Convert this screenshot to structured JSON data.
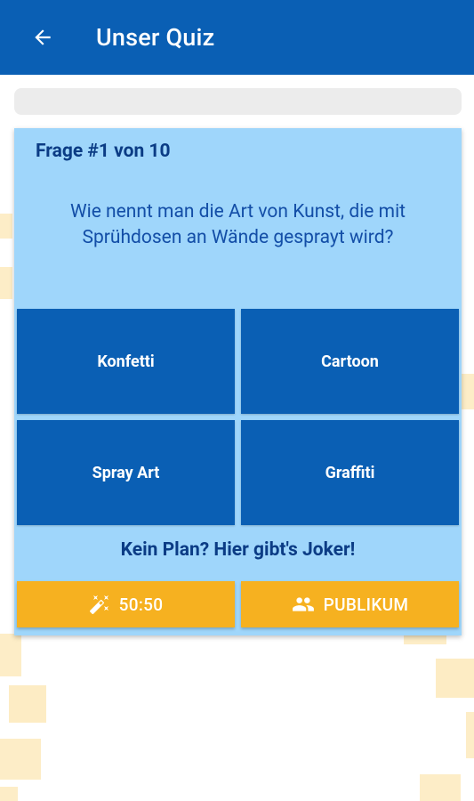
{
  "appbar": {
    "title": "Unser Quiz",
    "back_icon": "arrow-back-icon",
    "color": "#0a5fb4"
  },
  "progress": {
    "value": 0
  },
  "question": {
    "counter": "Frage #1 von 10",
    "text": "Wie nennt man die Art von Kunst, die mit Sprühdosen an Wände gesprayt wird?"
  },
  "answers": [
    {
      "label": "Konfetti"
    },
    {
      "label": "Cartoon"
    },
    {
      "label": "Spray Art"
    },
    {
      "label": "Graffiti"
    }
  ],
  "jokers": {
    "hint": "Kein Plan? Hier gibt's Joker!",
    "fifty_fifty": {
      "label": "50:50",
      "icon": "magic-wand-icon"
    },
    "audience": {
      "label": "PUBLIKUM",
      "icon": "people-icon"
    }
  },
  "colors": {
    "primary": "#0a5fb4",
    "card": "#9fd6fb",
    "joker": "#f6b120",
    "text_dark": "#0b3c85"
  }
}
